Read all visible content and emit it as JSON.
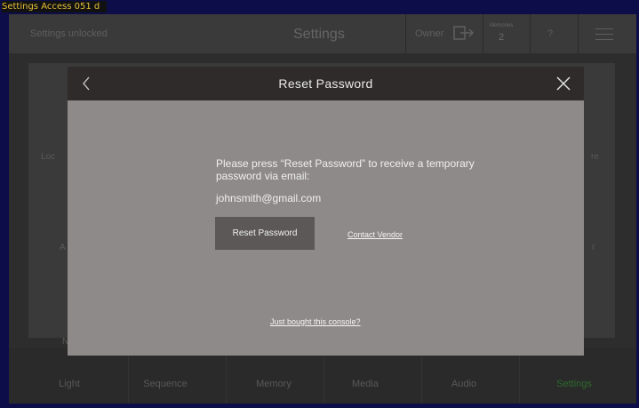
{
  "window_label": "Settings Access 051 d",
  "header": {
    "status": "Settings unlocked",
    "title": "Settings",
    "owner": "Owner",
    "memories_label": "Memories",
    "memories_value": "2",
    "help": "?"
  },
  "grid_labels": {
    "left_top": "Loc",
    "left_mid": "A",
    "left_bottom": "N",
    "right_top": "re",
    "right_mid": "r"
  },
  "dialog": {
    "title": "Reset Password",
    "message": "Please press “Reset Password” to receive a temporary password via email:",
    "email": "johnsmith@gmail.com",
    "reset_button": "Reset Password",
    "contact_link": "Contact Vendor",
    "bought_link": "Just bought this console?"
  },
  "nav": {
    "items": [
      {
        "label": "Light"
      },
      {
        "label": "Sequence"
      },
      {
        "label": "Memory"
      },
      {
        "label": "Media"
      },
      {
        "label": "Audio"
      },
      {
        "label": "Settings"
      }
    ],
    "active": "Settings"
  },
  "colors": {
    "background": "#0d0d4a",
    "dialog_body": "#8f8a8a",
    "dialog_header": "#2f2b2b",
    "button": "#5c5858",
    "active_nav": "#2c6b2c",
    "label_yellow": "#e8c23a"
  }
}
